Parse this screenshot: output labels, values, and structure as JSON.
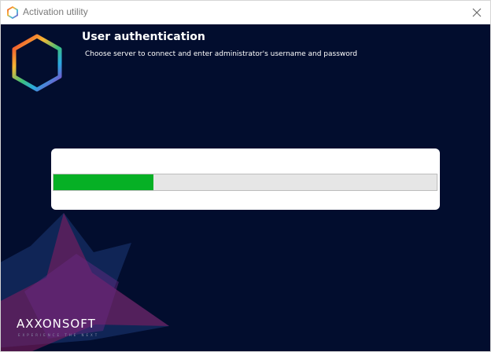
{
  "window": {
    "title": "Activation utility",
    "icon": "hexagon-logo-icon",
    "close_icon": "close-icon"
  },
  "header": {
    "title": "User authentication",
    "subtitle": "Choose server to connect and enter administrator's username and password"
  },
  "progress": {
    "value_percent": 26,
    "fill_color": "#06b025"
  },
  "brand": {
    "name": "AXXONSOFT",
    "tagline": "EXPERIENCE THE NEXT"
  },
  "colors": {
    "background": "#020d2e",
    "accent_magenta": "#a0206e",
    "accent_blue": "#1e5fa8"
  }
}
